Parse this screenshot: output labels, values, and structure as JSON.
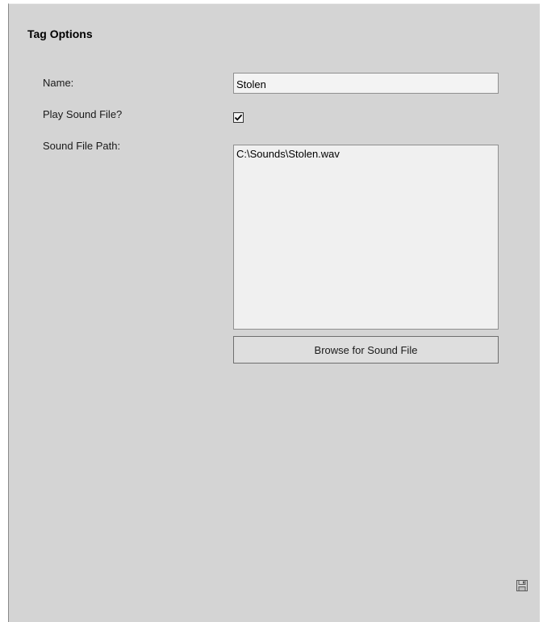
{
  "panel": {
    "title": "Tag Options"
  },
  "form": {
    "name_label": "Name:",
    "name_value": "Stolen",
    "play_sound_label": "Play Sound File?",
    "play_sound_checked": true,
    "sound_path_label": "Sound File Path:",
    "sound_path_value": "C:\\Sounds\\Stolen.wav",
    "browse_button_label": "Browse for Sound File"
  },
  "icons": {
    "check": "checkmark-icon",
    "save": "save-icon"
  },
  "colors": {
    "panel_background": "#d4d4d4",
    "input_background": "#f3f3f3",
    "button_background": "#dedede"
  }
}
